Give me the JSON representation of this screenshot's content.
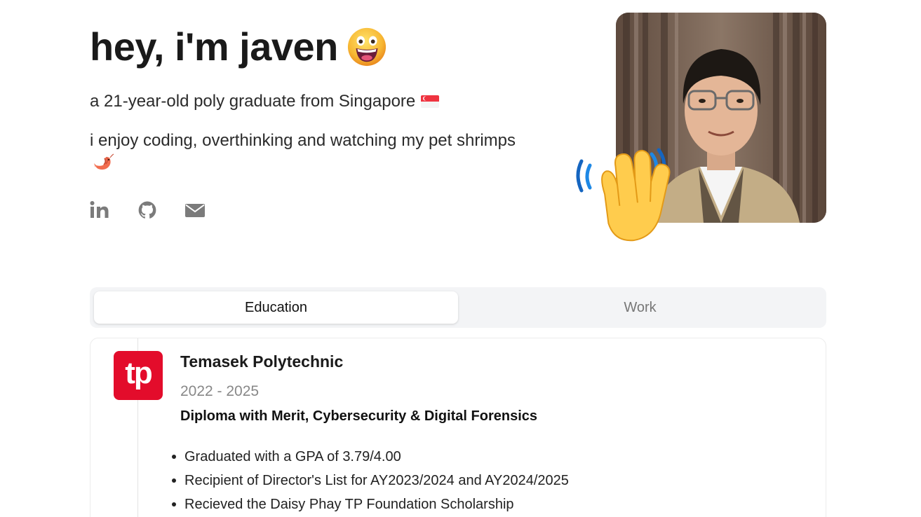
{
  "hero": {
    "title": "hey, i'm javen",
    "intro": "a 21-year-old poly graduate from Singapore",
    "hobbies": "i enjoy coding, overthinking and watching my pet shrimps"
  },
  "socials": [
    {
      "icon": "linkedin-icon"
    },
    {
      "icon": "github-icon"
    },
    {
      "icon": "mail-icon"
    }
  ],
  "tabs": [
    {
      "label": "Education",
      "active": true
    },
    {
      "label": "Work",
      "active": false
    }
  ],
  "education": [
    {
      "logo_text": "tp",
      "logo_color": "#e30c2b",
      "school": "Temasek Polytechnic",
      "years": "2022 - 2025",
      "qualification": "Diploma with Merit, Cybersecurity & Digital Forensics",
      "highlights": [
        "Graduated with a GPA of 3.79/4.00",
        "Recipient of Director's List for AY2023/2024 and AY2024/2025",
        "Recieved the Daisy Phay TP Foundation Scholarship"
      ]
    }
  ]
}
